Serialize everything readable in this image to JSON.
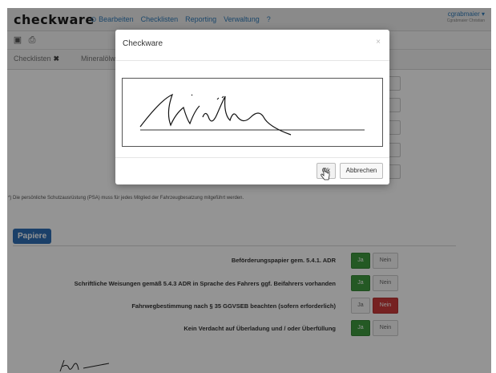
{
  "navbar": {
    "brand": "checkware",
    "links": [
      "Bearbeiten",
      "Checklisten",
      "Reporting",
      "Verwaltung",
      "?"
    ],
    "user_name": "cgrabmaier",
    "user_sub": "Cgrabmaier Christian"
  },
  "tabs": [
    {
      "label": "Checklisten",
      "close": "✖"
    },
    {
      "label": "Mineralölwe"
    }
  ],
  "footnote": "*) Die persönliche Schutzausrüstung (PSA) muss für jedes Mitglied der Fahrzeugbesatzung mitgeführt werden.",
  "section": {
    "label": "Papiere",
    "rows": [
      {
        "text": "Beförderungspapier gem. 5.4.1. ADR",
        "ja": "Ja",
        "nein": "Nein",
        "selected": "ja"
      },
      {
        "text": "Schriftliche Weisungen gemäß 5.4.3 ADR in Sprache des Fahrers ggf. Beifahrers vorhanden",
        "ja": "Ja",
        "nein": "Nein",
        "selected": "ja"
      },
      {
        "text": "Fahrwegbestimmung nach § 35 GGVSEB beachten (sofern erforderlich)",
        "ja": "Ja",
        "nein": "Nein",
        "selected": "nein"
      },
      {
        "text": "Kein Verdacht auf Überladung und / oder Überfüllung",
        "ja": "Ja",
        "nein": "Nein",
        "selected": "ja"
      }
    ]
  },
  "modal": {
    "title": "Checkware",
    "close": "×",
    "ok": "Ok",
    "cancel": "Abbrechen"
  },
  "colors": {
    "accent": "#2f6fb6",
    "ja_on": "#3f9a3f",
    "nein_on": "#cc3b3b"
  }
}
